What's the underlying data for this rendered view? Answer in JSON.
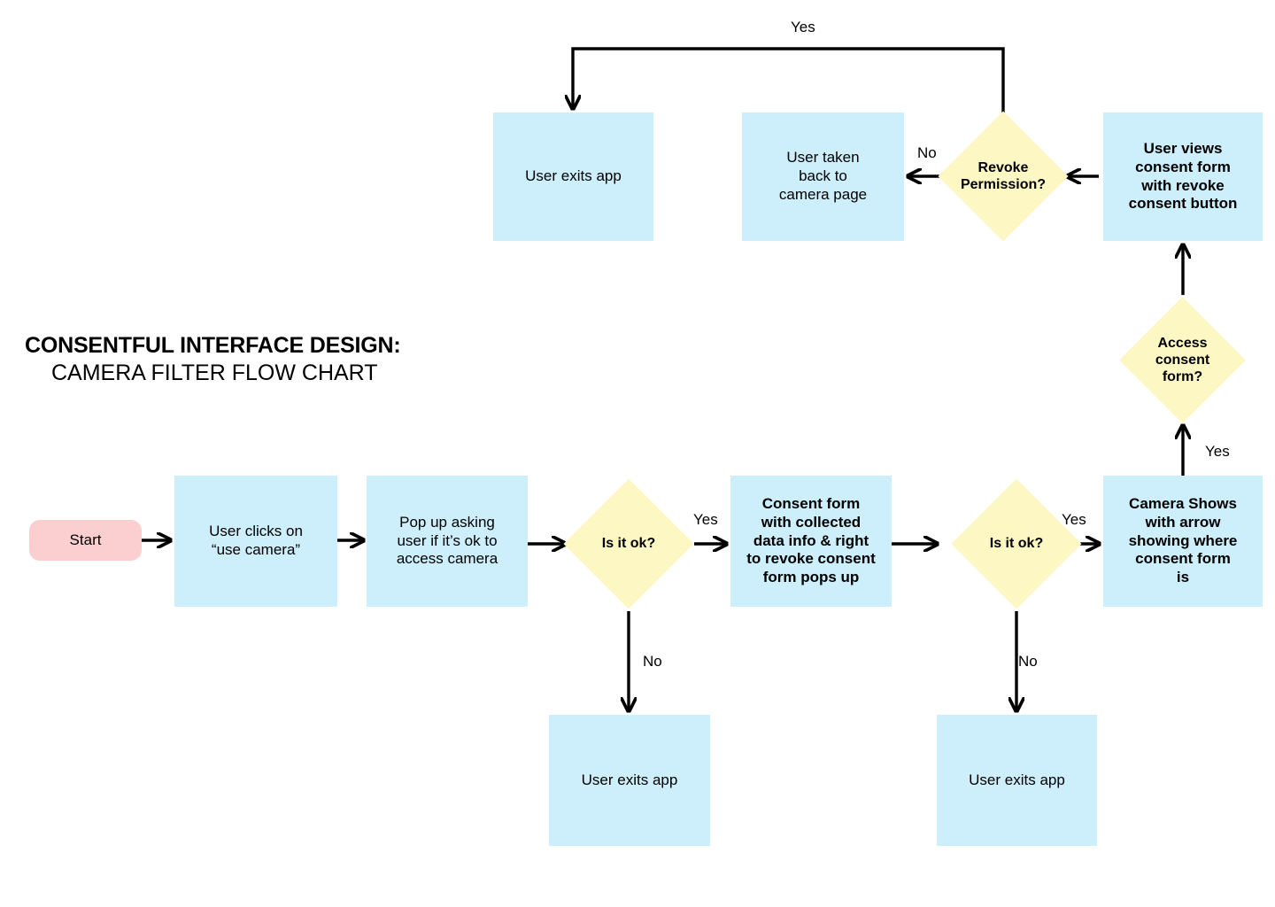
{
  "title": {
    "line1": "CONSENTFUL INTERFACE DESIGN:",
    "line2": "CAMERA FILTER FLOW CHART"
  },
  "colors": {
    "process": "#cdeefb",
    "decision": "#fdf7c3",
    "terminator": "#fbcfcf",
    "connector": "#000000",
    "text": "#000000",
    "background": "#ffffff"
  },
  "nodes": {
    "start": {
      "label": "Start",
      "shape": "terminator"
    },
    "user_clicks_camera": {
      "label": "User clicks on\n“use camera”",
      "shape": "process"
    },
    "popup_asking": {
      "label": "Pop up asking\nuser if it’s ok to\naccess camera",
      "shape": "process"
    },
    "decision_ok_1": {
      "label": "Is it ok?",
      "shape": "decision"
    },
    "consent_form_popup": {
      "label": "Consent form\nwith collected\ndata info & right\nto revoke consent\nform pops up",
      "shape": "process"
    },
    "decision_ok_2": {
      "label": "Is it ok?",
      "shape": "decision"
    },
    "camera_shows": {
      "label": "Camera Shows\nwith arrow\nshowing where\nconsent form\nis",
      "shape": "process"
    },
    "decision_access_consent": {
      "label": "Access\nconsent\nform?",
      "shape": "decision"
    },
    "user_views_consent": {
      "label": "User views\nconsent form\nwith revoke\nconsent button",
      "shape": "process"
    },
    "decision_revoke": {
      "label": "Revoke\nPermission?",
      "shape": "decision"
    },
    "user_taken_back": {
      "label": "User taken\nback to\ncamera page",
      "shape": "process"
    },
    "exits_top": {
      "label": "User exits app",
      "shape": "process"
    },
    "exits_mid": {
      "label": "User exits app",
      "shape": "process"
    },
    "exits_right": {
      "label": "User exits app",
      "shape": "process"
    }
  },
  "edge_labels": {
    "yes_ok_1": "Yes",
    "no_ok_1": "No",
    "yes_ok_2": "Yes",
    "no_ok_2": "No",
    "yes_access_consent": "Yes",
    "no_revoke": "No",
    "yes_revoke": "Yes"
  }
}
